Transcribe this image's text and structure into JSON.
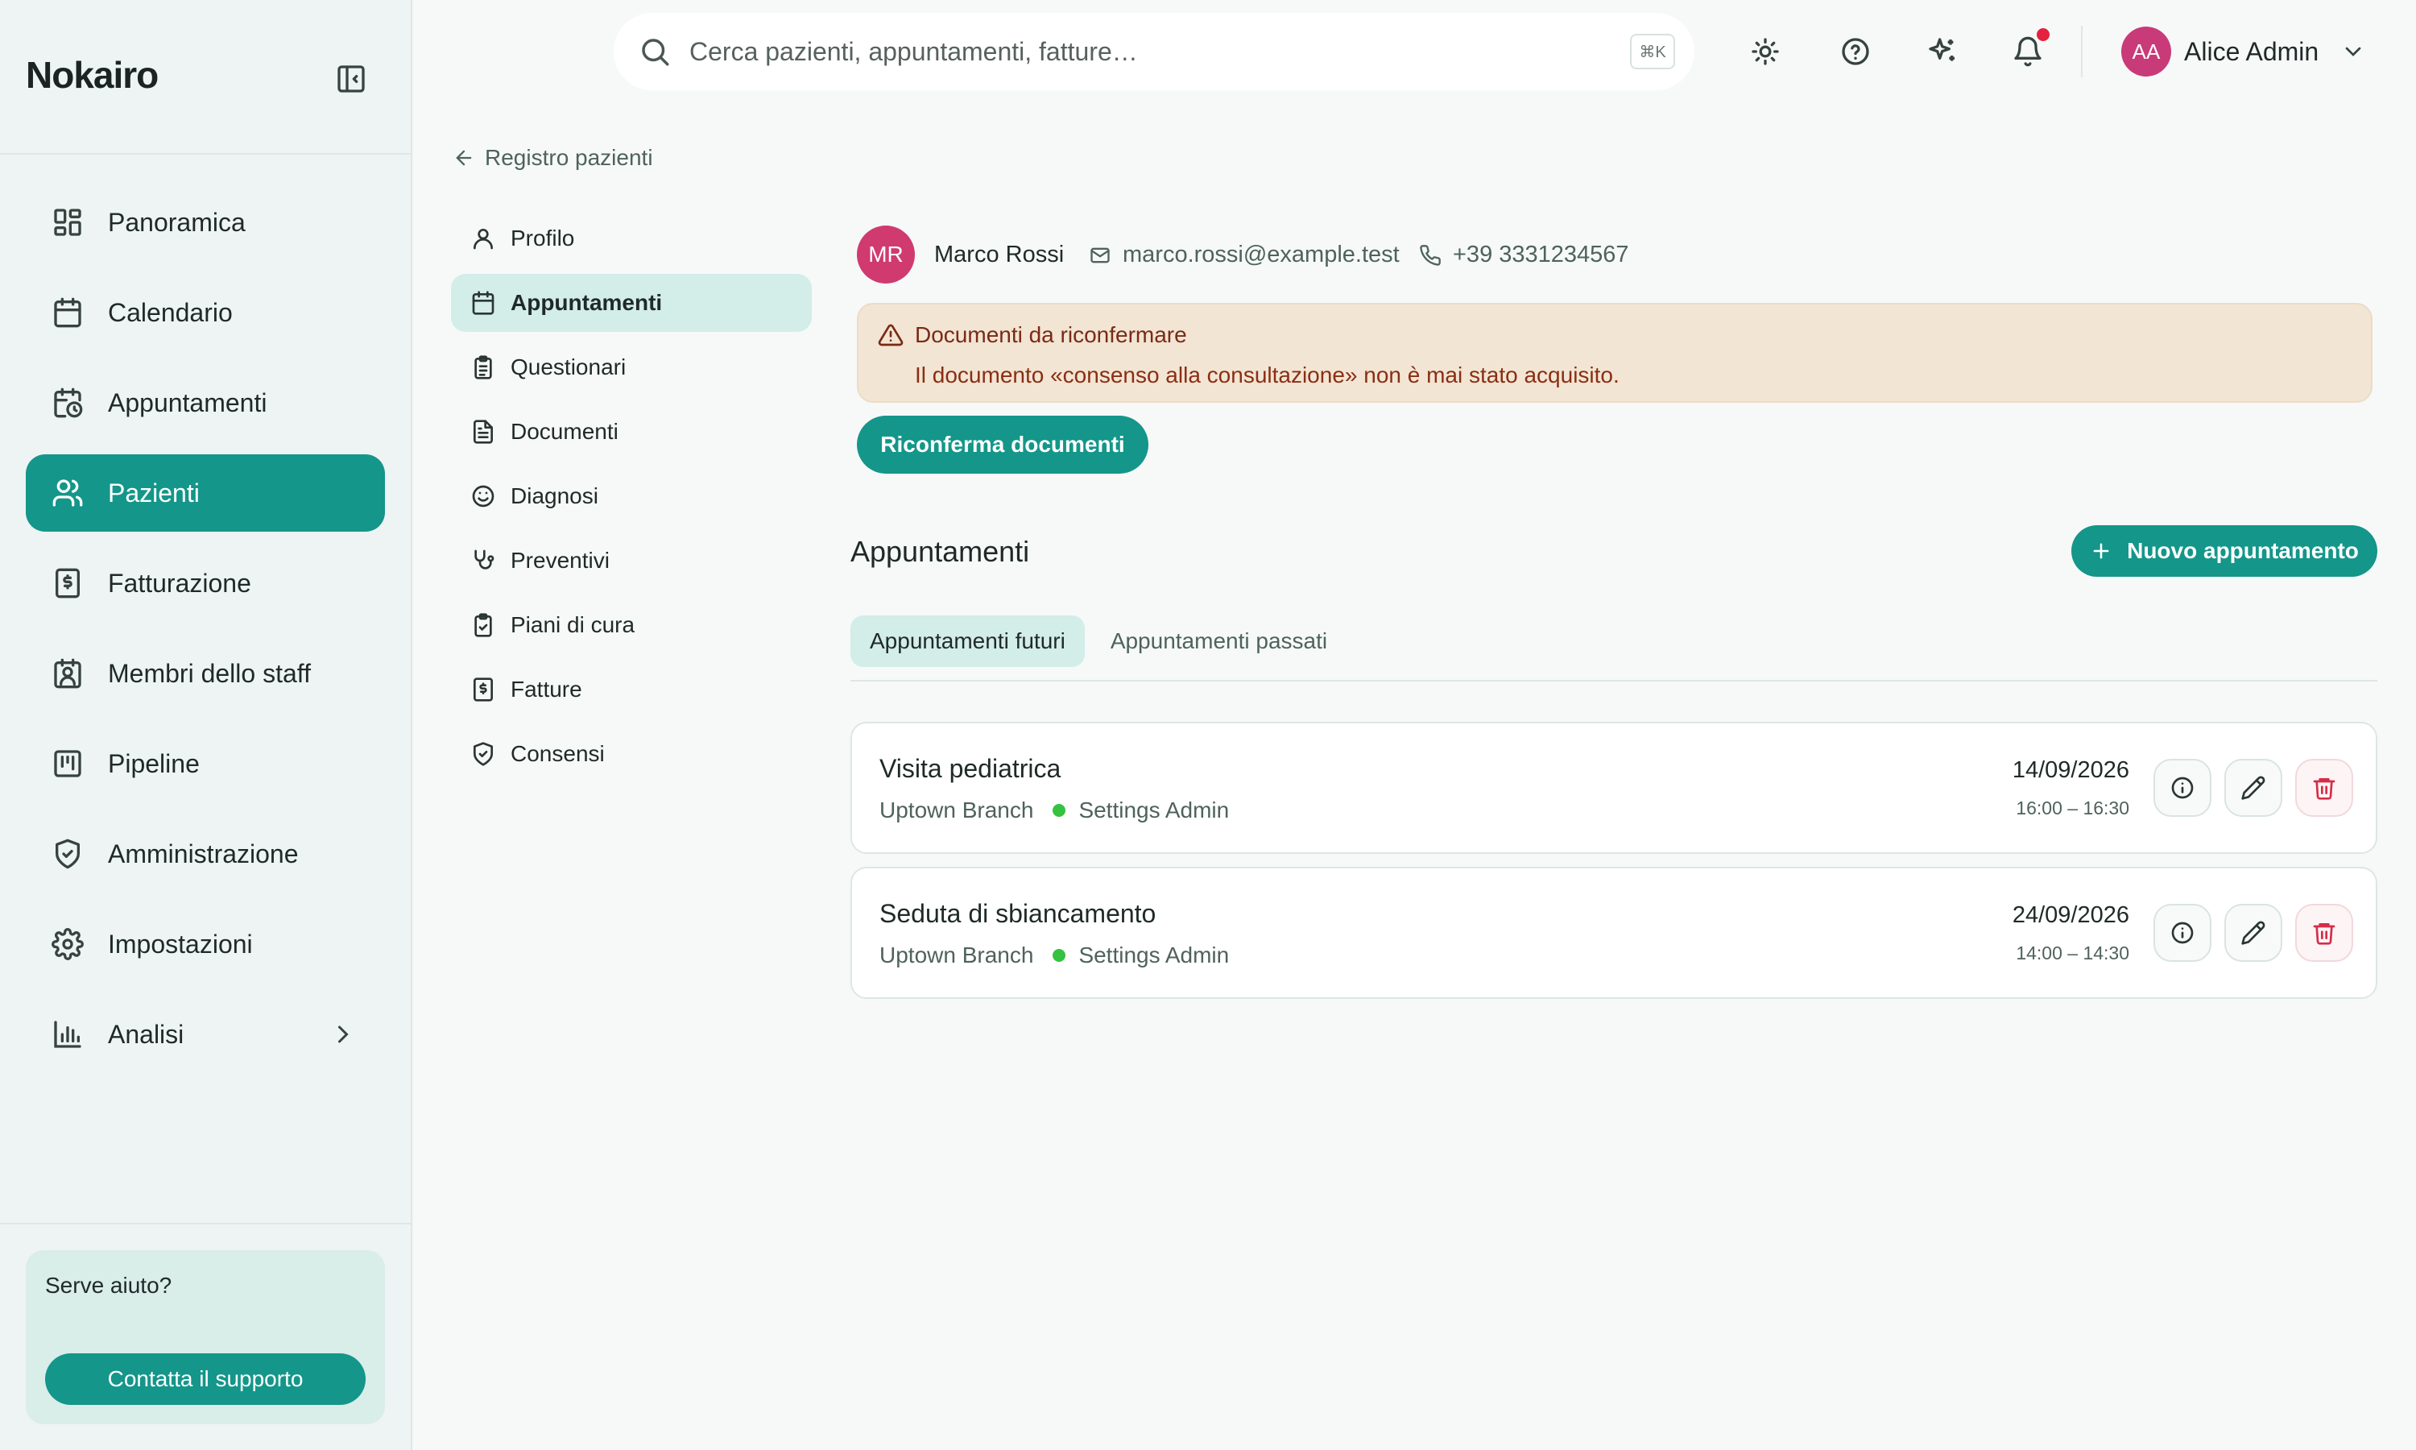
{
  "app": {
    "brand": "Nokairo"
  },
  "sidebar": {
    "items": [
      {
        "label": "Panoramica",
        "icon": "dashboard-icon"
      },
      {
        "label": "Calendario",
        "icon": "calendar-icon"
      },
      {
        "label": "Appuntamenti",
        "icon": "calendar-clock-icon"
      },
      {
        "label": "Pazienti",
        "icon": "users-icon",
        "active": true
      },
      {
        "label": "Fatturazione",
        "icon": "receipt-icon"
      },
      {
        "label": "Membri dello staff",
        "icon": "staff-badge-icon"
      },
      {
        "label": "Pipeline",
        "icon": "kanban-icon"
      },
      {
        "label": "Amministrazione",
        "icon": "shield-check-icon"
      },
      {
        "label": "Impostazioni",
        "icon": "gear-icon"
      },
      {
        "label": "Analisi",
        "icon": "bar-chart-icon"
      }
    ],
    "help": {
      "title": "Serve aiuto?",
      "button": "Contatta il supporto"
    }
  },
  "topbar": {
    "search_placeholder": "Cerca pazienti, appuntamenti, fatture…",
    "shortcut": "⌘K",
    "user": {
      "initials": "AA",
      "name": "Alice Admin"
    }
  },
  "breadcrumb": {
    "back_label": "Registro pazienti"
  },
  "subnav": {
    "items": [
      {
        "label": "Profilo",
        "icon": "user-icon"
      },
      {
        "label": "Appuntamenti",
        "icon": "calendar-icon",
        "active": true
      },
      {
        "label": "Questionari",
        "icon": "clipboard-list-icon"
      },
      {
        "label": "Documenti",
        "icon": "document-icon"
      },
      {
        "label": "Diagnosi",
        "icon": "smile-icon"
      },
      {
        "label": "Preventivi",
        "icon": "stethoscope-icon"
      },
      {
        "label": "Piani di cura",
        "icon": "clipboard-check-icon"
      },
      {
        "label": "Fatture",
        "icon": "receipt-icon"
      },
      {
        "label": "Consensi",
        "icon": "shield-check-icon"
      }
    ]
  },
  "patient": {
    "initials": "MR",
    "name": "Marco Rossi",
    "email": "marco.rossi@example.test",
    "phone": "+39 3331234567"
  },
  "alert": {
    "title": "Documenti da riconfermare",
    "body": "Il documento «consenso alla consultazione» non è mai stato acquisito.",
    "button": "Riconferma documenti"
  },
  "appointments": {
    "title": "Appuntamenti",
    "new_button": "Nuovo appuntamento",
    "tabs": [
      {
        "label": "Appuntamenti futuri",
        "active": true
      },
      {
        "label": "Appuntamenti passati"
      }
    ],
    "items": [
      {
        "title": "Visita pediatrica",
        "branch": "Uptown Branch",
        "staff": "Settings Admin",
        "date": "14/09/2026",
        "time": "16:00 – 16:30"
      },
      {
        "title": "Seduta di sbiancamento",
        "branch": "Uptown Branch",
        "staff": "Settings Admin",
        "date": "24/09/2026",
        "time": "14:00 – 14:30"
      }
    ]
  },
  "colors": {
    "accent": "#14968a",
    "status_dot": "#35c241",
    "alert_bg": "#f2e5d3",
    "danger": "#d62c48"
  }
}
